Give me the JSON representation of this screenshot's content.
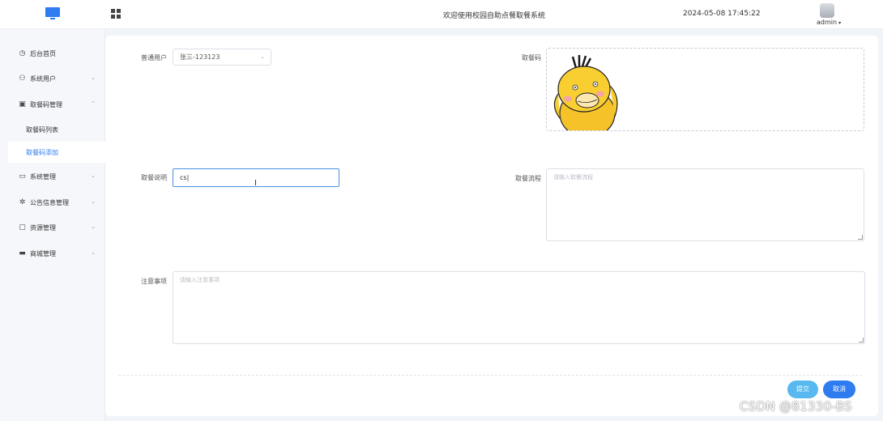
{
  "header": {
    "title": "欢迎使用校园自助点餐取餐系统",
    "datetime": "2024-05-08 17:45:22",
    "user": "admin"
  },
  "sidebar": {
    "items": [
      {
        "label": "后台首页",
        "icon": "clock-icon"
      },
      {
        "label": "系统用户",
        "icon": "user-icon"
      },
      {
        "label": "取餐码管理",
        "icon": "box-icon"
      },
      {
        "label": "取餐码列表"
      },
      {
        "label": "取餐码添加"
      },
      {
        "label": "系统管理",
        "icon": "folder-icon"
      },
      {
        "label": "公告信息管理",
        "icon": "broadcast-icon"
      },
      {
        "label": "资源管理",
        "icon": "monitor-icon"
      },
      {
        "label": "商城管理",
        "icon": "shop-icon"
      }
    ]
  },
  "form": {
    "user_label": "普通用户",
    "user_value": "张三-123123",
    "code_label": "取餐码",
    "desc_label": "取餐说明",
    "desc_value": "cs",
    "process_label": "取餐流程",
    "process_placeholder": "请输入取餐流程",
    "notes_label": "注意事项",
    "notes_placeholder": "请输入注意事项",
    "submit_label": "提交",
    "cancel_label": "取消"
  },
  "watermark": "CSDN @81330-BS",
  "colors": {
    "accent": "#2f7bf0",
    "submit": "#58b9f0"
  }
}
